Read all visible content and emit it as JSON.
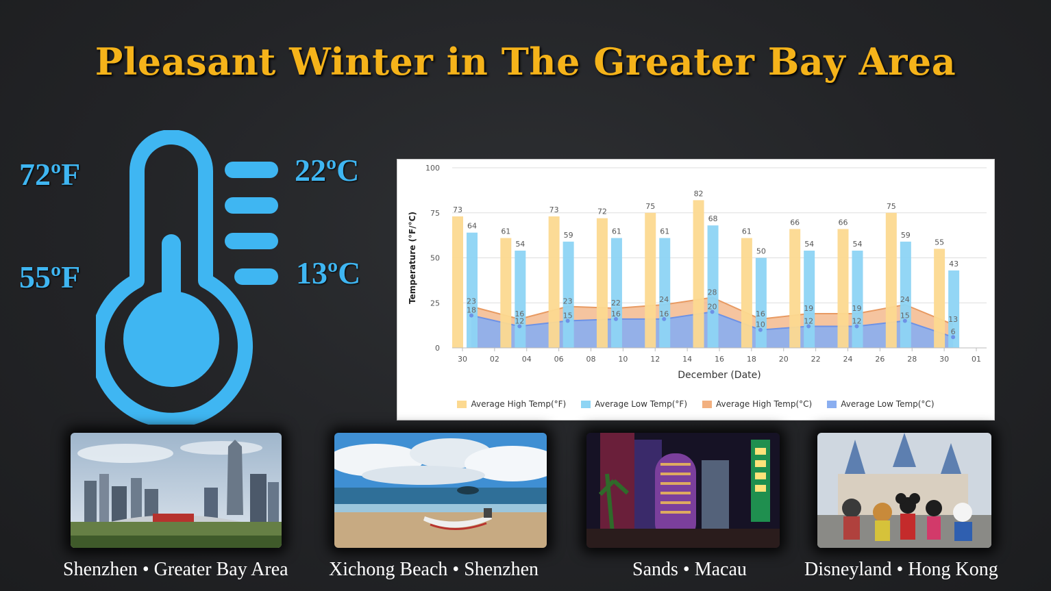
{
  "title": "Pleasant Winter in The Greater Bay Area",
  "temps": {
    "high_f": "72ºF",
    "high_c": "22ºC",
    "low_f": "55ºF",
    "low_c": "13ºC"
  },
  "icon": "thermometer-icon",
  "colors": {
    "title": "#f5b31a",
    "temp_text": "#3fb6f2",
    "thermometer": "#3fb6f2",
    "high_f_bar": "#fcd990",
    "low_f_bar": "#8dd4f4",
    "high_c_area": "#f2b07f",
    "low_c_area": "#8aaef0"
  },
  "chart_data": {
    "type": "bar",
    "xlabel": "December (Date)",
    "ylabel": "Temperature (°F/°C)",
    "ylim": [
      0,
      100
    ],
    "yticks": [
      "0",
      "25",
      "50",
      "75",
      "100"
    ],
    "xticks": [
      "30",
      "02",
      "04",
      "06",
      "08",
      "10",
      "12",
      "14",
      "16",
      "18",
      "20",
      "22",
      "24",
      "26",
      "28",
      "30",
      "01"
    ],
    "x": [
      "11-30",
      "12-03",
      "12-06",
      "12-09",
      "12-12",
      "12-15",
      "12-18",
      "12-21",
      "12-24",
      "12-27",
      "12-30"
    ],
    "grid": true,
    "legend_position": "bottom",
    "series": [
      {
        "name": "Average High Temp(°F)",
        "type": "bar",
        "values": [
          73,
          61,
          73,
          72,
          75,
          82,
          61,
          66,
          66,
          75,
          55
        ]
      },
      {
        "name": "Average Low Temp(°F)",
        "type": "bar",
        "values": [
          64,
          54,
          59,
          61,
          61,
          68,
          50,
          54,
          54,
          59,
          43
        ]
      },
      {
        "name": "Average High Temp(°C)",
        "type": "area",
        "values": [
          23,
          16,
          23,
          22,
          24,
          28,
          16,
          19,
          19,
          24,
          13
        ]
      },
      {
        "name": "Average Low Temp(°C)",
        "type": "area",
        "values": [
          18,
          12,
          15,
          16,
          16,
          20,
          10,
          12,
          12,
          15,
          6
        ]
      }
    ]
  },
  "photos": [
    {
      "caption": "Shenzhen • Greater Bay Area"
    },
    {
      "caption": "Xichong Beach • Shenzhen"
    },
    {
      "caption": "Sands • Macau"
    },
    {
      "caption": "Disneyland • Hong Kong"
    }
  ]
}
